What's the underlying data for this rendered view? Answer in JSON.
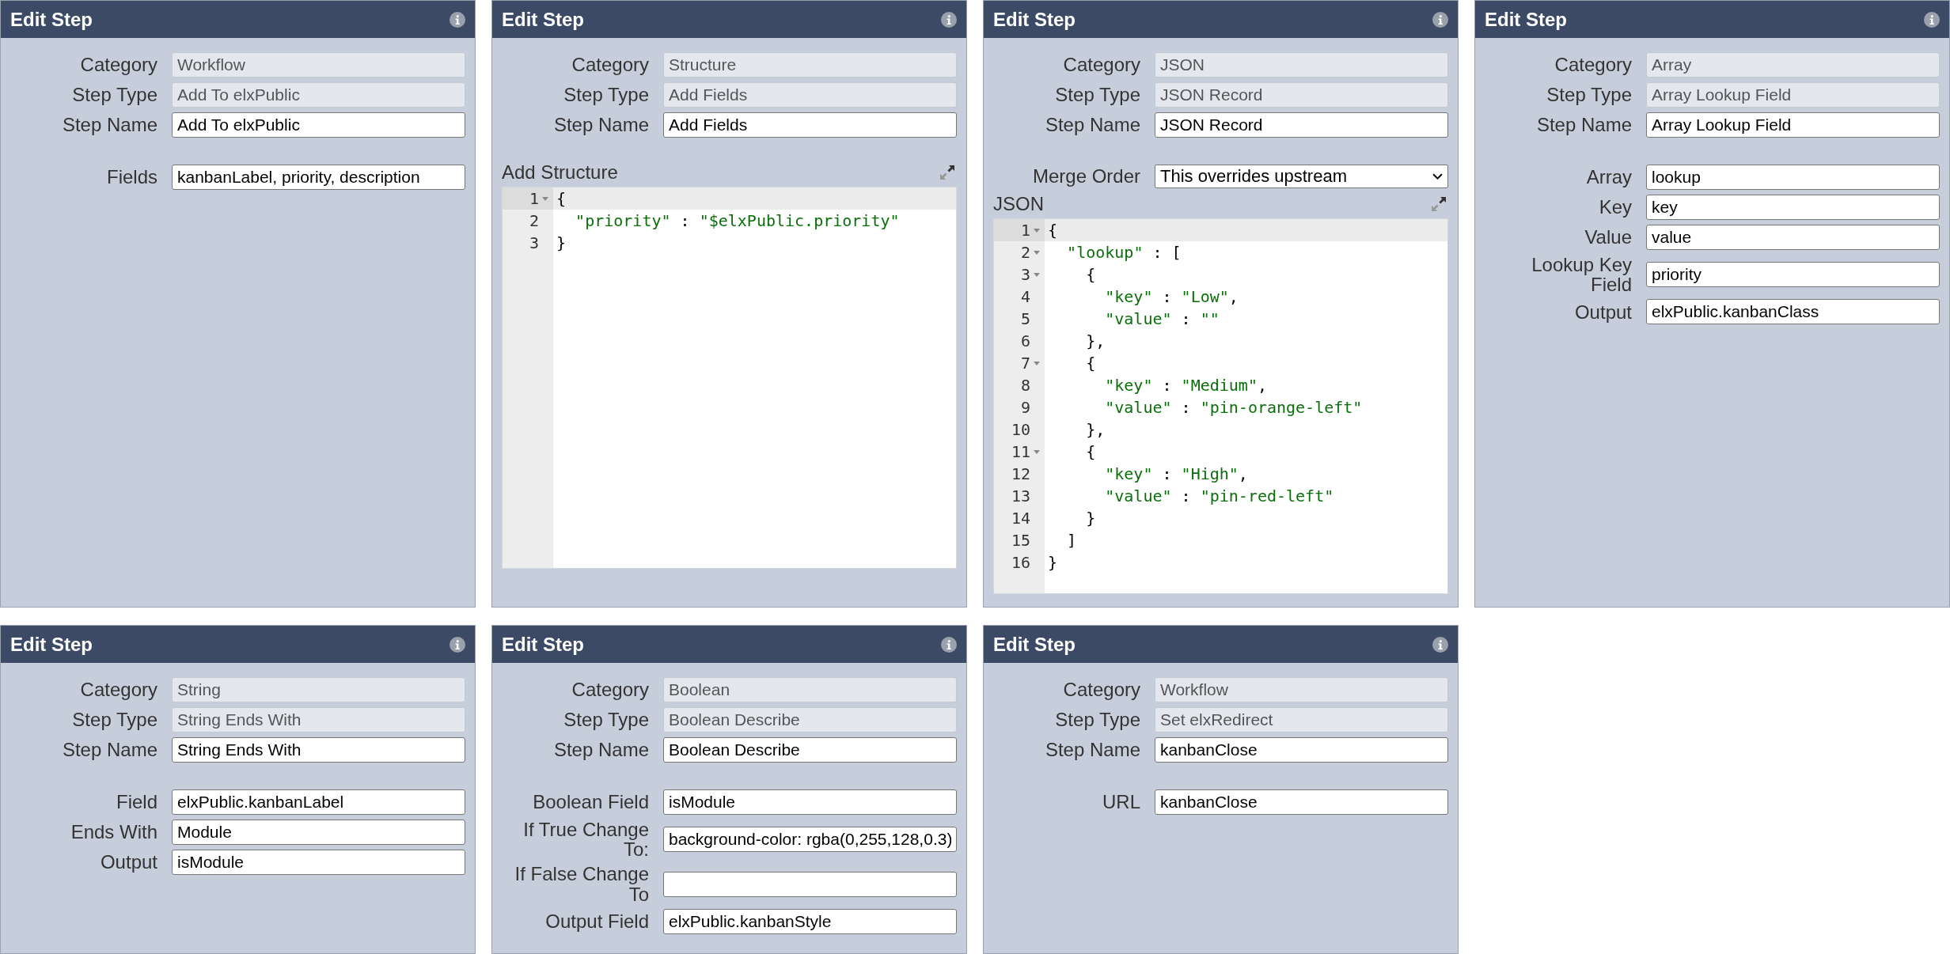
{
  "panels": [
    {
      "title": "Edit Step",
      "fields": [
        {
          "label": "Category",
          "value": "Workflow",
          "kind": "readonly"
        },
        {
          "label": "Step Type",
          "value": "Add To elxPublic",
          "kind": "readonly"
        },
        {
          "label": "Step Name",
          "value": "Add To elxPublic",
          "kind": "text"
        }
      ],
      "settings": [
        {
          "label": "Fields",
          "value": "kanbanLabel, priority, description",
          "kind": "text"
        }
      ]
    },
    {
      "title": "Edit Step",
      "fields": [
        {
          "label": "Category",
          "value": "Structure",
          "kind": "readonly"
        },
        {
          "label": "Step Type",
          "value": "Add Fields",
          "kind": "readonly"
        },
        {
          "label": "Step Name",
          "value": "Add Fields",
          "kind": "text"
        }
      ],
      "editor": {
        "label": "Add Structure",
        "lines": [
          {
            "number": "1",
            "text": "{",
            "foldable": true,
            "active": true
          },
          {
            "number": "2",
            "text": "  \"priority\" : \"$elxPublic.priority\"",
            "foldable": false,
            "active": false
          },
          {
            "number": "3",
            "text": "}",
            "foldable": false,
            "active": false
          }
        ]
      }
    },
    {
      "title": "Edit Step",
      "fields": [
        {
          "label": "Category",
          "value": "JSON",
          "kind": "readonly"
        },
        {
          "label": "Step Type",
          "value": "JSON Record",
          "kind": "readonly"
        },
        {
          "label": "Step Name",
          "value": "JSON Record",
          "kind": "text"
        }
      ],
      "settings": [
        {
          "label": "Merge Order",
          "value": "This overrides upstream",
          "kind": "select"
        }
      ],
      "editor": {
        "label": "JSON",
        "lines": [
          {
            "number": "1",
            "text": "{",
            "foldable": true,
            "active": true
          },
          {
            "number": "2",
            "text": "  \"lookup\" : [",
            "foldable": true,
            "active": false
          },
          {
            "number": "3",
            "text": "    {",
            "foldable": true,
            "active": false
          },
          {
            "number": "4",
            "text": "      \"key\" : \"Low\",",
            "foldable": false,
            "active": false
          },
          {
            "number": "5",
            "text": "      \"value\" : \"\"",
            "foldable": false,
            "active": false
          },
          {
            "number": "6",
            "text": "    },",
            "foldable": false,
            "active": false
          },
          {
            "number": "7",
            "text": "    {",
            "foldable": true,
            "active": false
          },
          {
            "number": "8",
            "text": "      \"key\" : \"Medium\",",
            "foldable": false,
            "active": false
          },
          {
            "number": "9",
            "text": "      \"value\" : \"pin-orange-left\"",
            "foldable": false,
            "active": false
          },
          {
            "number": "10",
            "text": "    },",
            "foldable": false,
            "active": false
          },
          {
            "number": "11",
            "text": "    {",
            "foldable": true,
            "active": false
          },
          {
            "number": "12",
            "text": "      \"key\" : \"High\",",
            "foldable": false,
            "active": false
          },
          {
            "number": "13",
            "text": "      \"value\" : \"pin-red-left\"",
            "foldable": false,
            "active": false
          },
          {
            "number": "14",
            "text": "    }",
            "foldable": false,
            "active": false
          },
          {
            "number": "15",
            "text": "  ]",
            "foldable": false,
            "active": false
          },
          {
            "number": "16",
            "text": "}",
            "foldable": false,
            "active": false
          }
        ]
      }
    },
    {
      "title": "Edit Step",
      "fields": [
        {
          "label": "Category",
          "value": "Array",
          "kind": "readonly"
        },
        {
          "label": "Step Type",
          "value": "Array Lookup Field",
          "kind": "readonly"
        },
        {
          "label": "Step Name",
          "value": "Array Lookup Field",
          "kind": "text"
        }
      ],
      "settings": [
        {
          "label": "Array",
          "value": "lookup",
          "kind": "text"
        },
        {
          "label": "Key",
          "value": "key",
          "kind": "text"
        },
        {
          "label": "Value",
          "value": "value",
          "kind": "text"
        },
        {
          "label": "Lookup Key Field",
          "value": "priority",
          "kind": "text"
        },
        {
          "label": "Output",
          "value": "elxPublic.kanbanClass",
          "kind": "text"
        }
      ]
    },
    {
      "title": "Edit Step",
      "fields": [
        {
          "label": "Category",
          "value": "String",
          "kind": "readonly"
        },
        {
          "label": "Step Type",
          "value": "String Ends With",
          "kind": "readonly"
        },
        {
          "label": "Step Name",
          "value": "String Ends With",
          "kind": "text"
        }
      ],
      "settings": [
        {
          "label": "Field",
          "value": "elxPublic.kanbanLabel",
          "kind": "text"
        },
        {
          "label": "Ends With",
          "value": "Module",
          "kind": "text"
        },
        {
          "label": "Output",
          "value": "isModule",
          "kind": "text"
        }
      ]
    },
    {
      "title": "Edit Step",
      "fields": [
        {
          "label": "Category",
          "value": "Boolean",
          "kind": "readonly"
        },
        {
          "label": "Step Type",
          "value": "Boolean Describe",
          "kind": "readonly"
        },
        {
          "label": "Step Name",
          "value": "Boolean Describe",
          "kind": "text"
        }
      ],
      "settings": [
        {
          "label": "Boolean Field",
          "value": "isModule",
          "kind": "text"
        },
        {
          "label": "If True Change To:",
          "value": "background-color: rgba(0,255,128,0.3)",
          "kind": "text"
        },
        {
          "label": "If False Change To",
          "kind": "text"
        },
        {
          "label": "Output Field",
          "value": "elxPublic.kanbanStyle",
          "kind": "text"
        }
      ]
    },
    {
      "title": "Edit Step",
      "fields": [
        {
          "label": "Category",
          "value": "Workflow",
          "kind": "readonly"
        },
        {
          "label": "Step Type",
          "value": "Set elxRedirect",
          "kind": "readonly"
        },
        {
          "label": "Step Name",
          "value": "kanbanClose",
          "kind": "text"
        }
      ],
      "settings": [
        {
          "label": "URL",
          "value": "kanbanClose",
          "kind": "text"
        }
      ]
    }
  ]
}
